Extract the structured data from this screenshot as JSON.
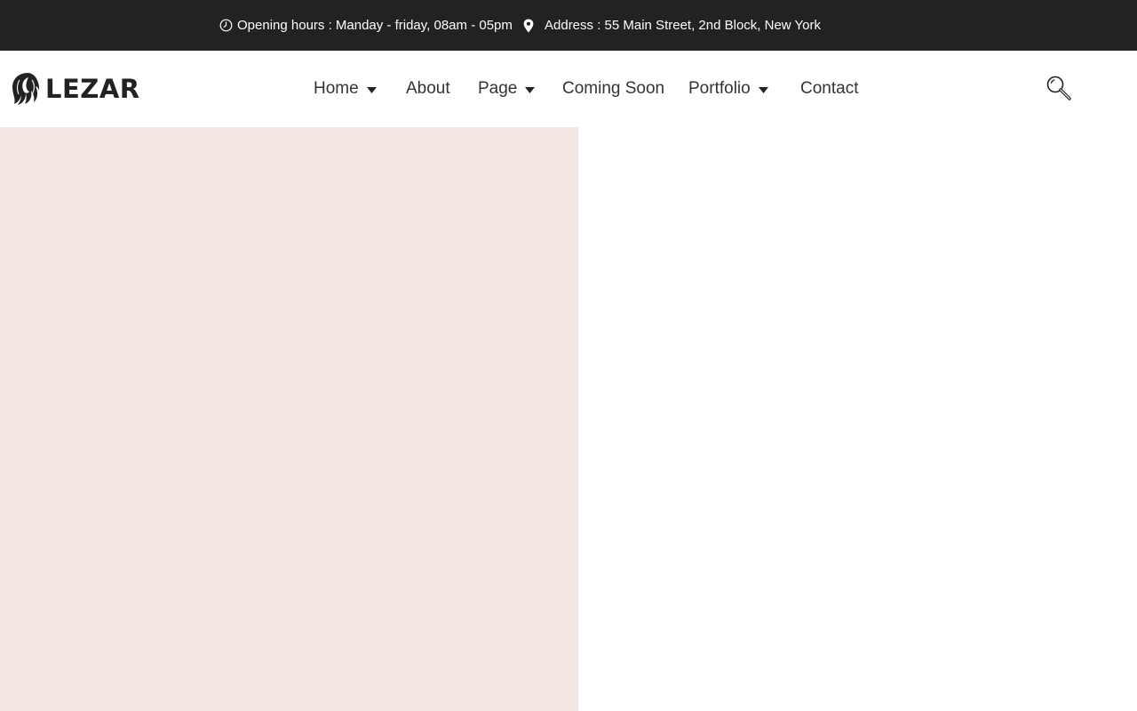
{
  "topbar": {
    "hours": {
      "icon": "clock-icon",
      "text": "Opening hours : Manday - friday, 08am - 05pm"
    },
    "address": {
      "icon": "map-pin-icon",
      "text": "Address : 55 Main Street, 2nd Block, New York"
    }
  },
  "header": {
    "logo": {
      "icon": "hair-silhouette-logo-icon",
      "text": "LEZAR"
    },
    "nav": [
      {
        "label": "Home",
        "has_dropdown": true
      },
      {
        "label": "About",
        "has_dropdown": false
      },
      {
        "label": "Page",
        "has_dropdown": true
      },
      {
        "label": "Coming Soon",
        "has_dropdown": false
      },
      {
        "label": "Portfolio",
        "has_dropdown": true
      },
      {
        "label": "Contact",
        "has_dropdown": false
      }
    ],
    "search": {
      "icon": "search-icon"
    }
  },
  "colors": {
    "topbar_bg": "#222222",
    "hero_left_bg": "#f5e7e3",
    "page_bg": "#ffffff",
    "text_dark": "#222222"
  }
}
